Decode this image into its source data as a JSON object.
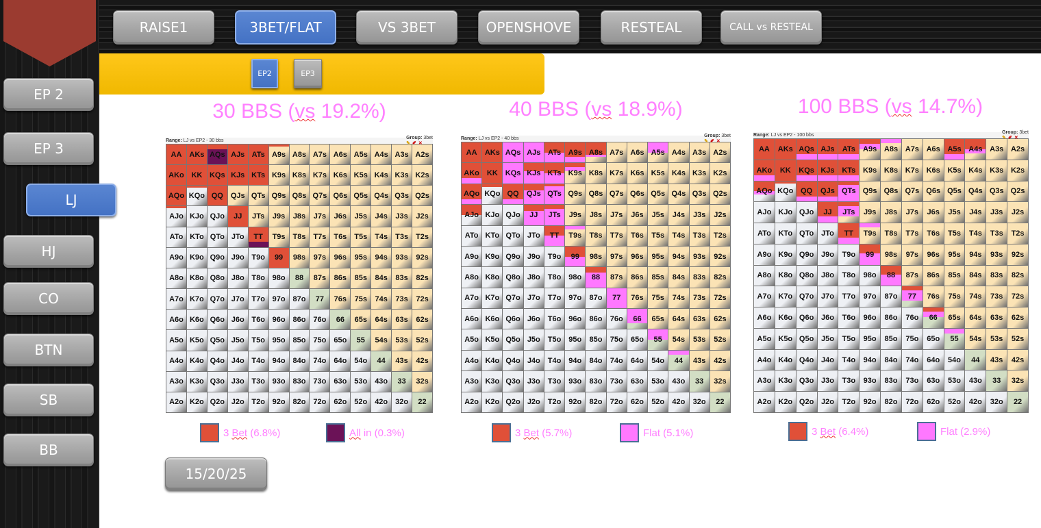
{
  "top_nav": {
    "items": [
      "RAISE1",
      "3BET/FLAT",
      "VS 3BET",
      "OPENSHOVE",
      "RESTEAL",
      "CALL vs RESTEAL"
    ],
    "active": "3BET/FLAT"
  },
  "sub_nav": {
    "items": [
      "EP2",
      "EP3"
    ],
    "active": "EP2"
  },
  "sidebar": {
    "items": [
      "EP 2",
      "EP 3",
      "LJ",
      "HJ",
      "CO",
      "BTN",
      "SB",
      "BB"
    ],
    "active": "LJ"
  },
  "colors": {
    "r": "#e05038",
    "f": "#ff78ff",
    "p": "#6b1257",
    "pair": "#d2dec4",
    "suited": "#fbe3b5",
    "offsuit": "#eef0f4",
    "title": "#ff80ff"
  },
  "hands": [
    "AA",
    "AKs",
    "AQs",
    "AJs",
    "ATs",
    "A9s",
    "A8s",
    "A7s",
    "A6s",
    "A5s",
    "A4s",
    "A3s",
    "A2s",
    "AKo",
    "KK",
    "KQs",
    "KJs",
    "KTs",
    "K9s",
    "K8s",
    "K7s",
    "K6s",
    "K5s",
    "K4s",
    "K3s",
    "K2s",
    "AQo",
    "KQo",
    "QQ",
    "QJs",
    "QTs",
    "Q9s",
    "Q8s",
    "Q7s",
    "Q6s",
    "Q5s",
    "Q4s",
    "Q3s",
    "Q2s",
    "AJo",
    "KJo",
    "QJo",
    "JJ",
    "JTs",
    "J9s",
    "J8s",
    "J7s",
    "J6s",
    "J5s",
    "J4s",
    "J3s",
    "J2s",
    "ATo",
    "KTo",
    "QTo",
    "JTo",
    "TT",
    "T9s",
    "T8s",
    "T7s",
    "T6s",
    "T5s",
    "T4s",
    "T3s",
    "T2s",
    "A9o",
    "K9o",
    "Q9o",
    "J9o",
    "T9o",
    "99",
    "98s",
    "97s",
    "96s",
    "95s",
    "94s",
    "93s",
    "92s",
    "A8o",
    "K8o",
    "Q8o",
    "J8o",
    "T8o",
    "98o",
    "88",
    "87s",
    "86s",
    "85s",
    "84s",
    "83s",
    "82s",
    "A7o",
    "K7o",
    "Q7o",
    "J7o",
    "T7o",
    "97o",
    "87o",
    "77",
    "76s",
    "75s",
    "74s",
    "73s",
    "72s",
    "A6o",
    "K6o",
    "Q6o",
    "J6o",
    "T6o",
    "96o",
    "86o",
    "76o",
    "66",
    "65s",
    "64s",
    "63s",
    "62s",
    "A5o",
    "K5o",
    "Q5o",
    "J5o",
    "T5o",
    "95o",
    "85o",
    "75o",
    "65o",
    "55",
    "54s",
    "53s",
    "52s",
    "A4o",
    "K4o",
    "Q4o",
    "J4o",
    "T4o",
    "94o",
    "84o",
    "74o",
    "64o",
    "54o",
    "44",
    "43s",
    "42s",
    "A3o",
    "K3o",
    "Q3o",
    "J3o",
    "T3o",
    "93o",
    "83o",
    "73o",
    "63o",
    "53o",
    "43o",
    "33",
    "32s",
    "A2o",
    "K2o",
    "Q2o",
    "J2o",
    "T2o",
    "92o",
    "82o",
    "72o",
    "62o",
    "52o",
    "42o",
    "32o",
    "22"
  ],
  "panels": [
    {
      "title_pre": "30 BBS (",
      "title_vs": "vs",
      "title_post": " 19.2%)",
      "range_label": "Range:",
      "range_value": "LJ vs EP2 - 30 bbs",
      "group_label": "Group:",
      "group_value": "3bet",
      "legend": [
        {
          "key": "r",
          "pre": "3 ",
          "u": "Bet",
          "post": " (6.8%)"
        },
        {
          "key": "p",
          "pre": "",
          "u": "All",
          "post": " in (0.3%)"
        }
      ],
      "mix": {
        "AA": [
          [
            "r",
            1
          ]
        ],
        "AKs": [
          [
            "r",
            1
          ]
        ],
        "AQs": [
          [
            "r",
            0.25
          ],
          [
            "p",
            0.75
          ]
        ],
        "AJs": [
          [
            "r",
            1
          ]
        ],
        "ATs": [
          [
            "r",
            1
          ]
        ],
        "A9s": [
          [
            "r",
            0.1
          ]
        ],
        "AKo": [
          [
            "r",
            1
          ]
        ],
        "KK": [
          [
            "r",
            1
          ]
        ],
        "KQs": [
          [
            "r",
            1
          ]
        ],
        "KJs": [
          [
            "r",
            1
          ]
        ],
        "KTs": [
          [
            "r",
            1
          ]
        ],
        "AQo": [
          [
            "r",
            1
          ]
        ],
        "KQo": [
          [
            "r",
            0.1
          ]
        ],
        "QQ": [
          [
            "r",
            1
          ]
        ],
        "AJo": [
          [
            "r",
            0.1
          ]
        ],
        "JJ": [
          [
            "r",
            1
          ]
        ],
        "TT": [
          [
            "r",
            0.75
          ],
          [
            "p",
            0.25
          ]
        ],
        "99": [
          [
            "r",
            1
          ]
        ]
      }
    },
    {
      "title_pre": "40 BBS (",
      "title_vs": "vs",
      "title_post": " 18.9%)",
      "range_label": "Range:",
      "range_value": "LJ vs EP2 - 40 bbs",
      "group_label": "Group:",
      "group_value": "3bet",
      "legend": [
        {
          "key": "r",
          "pre": "3 ",
          "u": "Bet",
          "post": " (5.7%)"
        },
        {
          "key": "f",
          "pre": "",
          "u": "",
          "post": "Flat (5.1%)"
        }
      ],
      "mix": {
        "AA": [
          [
            "r",
            1
          ]
        ],
        "AKs": [
          [
            "r",
            1
          ]
        ],
        "AQs": [
          [
            "f",
            1
          ]
        ],
        "AJs": [
          [
            "f",
            1
          ]
        ],
        "ATs": [
          [
            "r",
            0.5
          ],
          [
            "f",
            0.5
          ]
        ],
        "A9s": [
          [
            "r",
            0.7
          ],
          [
            "f",
            0.3
          ]
        ],
        "A8s": [
          [
            "r",
            0.6
          ],
          [
            "f",
            0.12
          ]
        ],
        "A5s": [
          [
            "f",
            0.5
          ]
        ],
        "AKo": [
          [
            "r",
            0.75
          ],
          [
            "f",
            0.25
          ]
        ],
        "KK": [
          [
            "r",
            1
          ]
        ],
        "KQs": [
          [
            "f",
            1
          ]
        ],
        "KJs": [
          [
            "r",
            0.4
          ],
          [
            "f",
            0.6
          ]
        ],
        "KTs": [
          [
            "r",
            0.5
          ],
          [
            "f",
            0.5
          ]
        ],
        "K9s": [
          [
            "r",
            0.2
          ],
          [
            "f",
            0.2
          ]
        ],
        "AQo": [
          [
            "r",
            0.75
          ],
          [
            "f",
            0.25
          ]
        ],
        "KQo": [
          [
            "r",
            0.15
          ]
        ],
        "QQ": [
          [
            "r",
            0.75
          ],
          [
            "f",
            0.25
          ]
        ],
        "QJs": [
          [
            "r",
            0.3
          ],
          [
            "f",
            0.7
          ]
        ],
        "QTs": [
          [
            "r",
            0.1
          ],
          [
            "f",
            0.9
          ]
        ],
        "AJo": [
          [
            "r",
            0.5
          ]
        ],
        "JJ": [
          [
            "r",
            0.3
          ],
          [
            "f",
            0.7
          ]
        ],
        "JTs": [
          [
            "r",
            0.2
          ],
          [
            "f",
            0.8
          ]
        ],
        "TT": [
          [
            "r",
            0.5
          ],
          [
            "f",
            0.5
          ]
        ],
        "T9s": [
          [
            "f",
            0.2
          ]
        ],
        "99": [
          [
            "r",
            0.5
          ],
          [
            "f",
            0.5
          ]
        ],
        "88": [
          [
            "r",
            0.25
          ],
          [
            "f",
            0.75
          ]
        ],
        "77": [
          [
            "f",
            1
          ]
        ],
        "66": [
          [
            "f",
            0.7
          ]
        ],
        "55": [
          [
            "f",
            0.5
          ]
        ],
        "44": [
          [
            "f",
            0.2
          ]
        ]
      }
    },
    {
      "title_pre": "100 BBS (",
      "title_vs": "vs",
      "title_post": " 14.7%)",
      "range_label": "Range:",
      "range_value": "LJ vs EP2 - 100 bbs",
      "group_label": "Group:",
      "group_value": "3bet",
      "legend": [
        {
          "key": "r",
          "pre": "3 ",
          "u": "Bet",
          "post": " (6.4%)"
        },
        {
          "key": "f",
          "pre": "",
          "u": "",
          "post": "Flat (2.9%)"
        }
      ],
      "mix": {
        "AA": [
          [
            "r",
            1
          ]
        ],
        "AKs": [
          [
            "r",
            1
          ]
        ],
        "AQs": [
          [
            "r",
            0.75
          ],
          [
            "f",
            0.25
          ]
        ],
        "AJs": [
          [
            "r",
            0.75
          ],
          [
            "f",
            0.25
          ]
        ],
        "ATs": [
          [
            "r",
            0.75
          ],
          [
            "f",
            0.25
          ]
        ],
        "A9s": [
          [
            "r",
            0.25
          ],
          [
            "f",
            0.25
          ]
        ],
        "A8s": [
          [
            "f",
            0.2
          ]
        ],
        "A5s": [
          [
            "r",
            0.75
          ],
          [
            "f",
            0.25
          ]
        ],
        "A4s": [
          [
            "r",
            0.5
          ],
          [
            "f",
            0.2
          ]
        ],
        "AKo": [
          [
            "r",
            0.75
          ],
          [
            "f",
            0.25
          ]
        ],
        "KK": [
          [
            "r",
            1
          ]
        ],
        "KQs": [
          [
            "r",
            0.75
          ],
          [
            "f",
            0.25
          ]
        ],
        "KJs": [
          [
            "r",
            0.75
          ],
          [
            "f",
            0.25
          ]
        ],
        "KTs": [
          [
            "r",
            0.75
          ],
          [
            "f",
            0.25
          ]
        ],
        "AQo": [
          [
            "r",
            0.5
          ],
          [
            "f",
            0.15
          ]
        ],
        "KQo": [
          [
            "r",
            0.1
          ]
        ],
        "QQ": [
          [
            "r",
            0.75
          ],
          [
            "f",
            0.25
          ]
        ],
        "QJs": [
          [
            "r",
            0.75
          ],
          [
            "f",
            0.25
          ]
        ],
        "QTs": [
          [
            "r",
            0.2
          ],
          [
            "f",
            0.8
          ]
        ],
        "JJ": [
          [
            "r",
            0.7
          ],
          [
            "f",
            0.3
          ]
        ],
        "JTs": [
          [
            "r",
            0.2
          ],
          [
            "f",
            0.5
          ]
        ],
        "TT": [
          [
            "r",
            0.7
          ],
          [
            "f",
            0.3
          ]
        ],
        "T9s": [
          [
            "f",
            0.2
          ]
        ],
        "99": [
          [
            "r",
            0.45
          ],
          [
            "f",
            0.55
          ]
        ],
        "88": [
          [
            "r",
            0.45
          ],
          [
            "f",
            0.55
          ]
        ],
        "77": [
          [
            "r",
            0.2
          ],
          [
            "f",
            0.5
          ]
        ],
        "66": [
          [
            "r",
            0.2
          ],
          [
            "f",
            0.25
          ]
        ],
        "55": [
          [
            "f",
            0.25
          ]
        ]
      }
    }
  ],
  "date_button": "15/20/25"
}
